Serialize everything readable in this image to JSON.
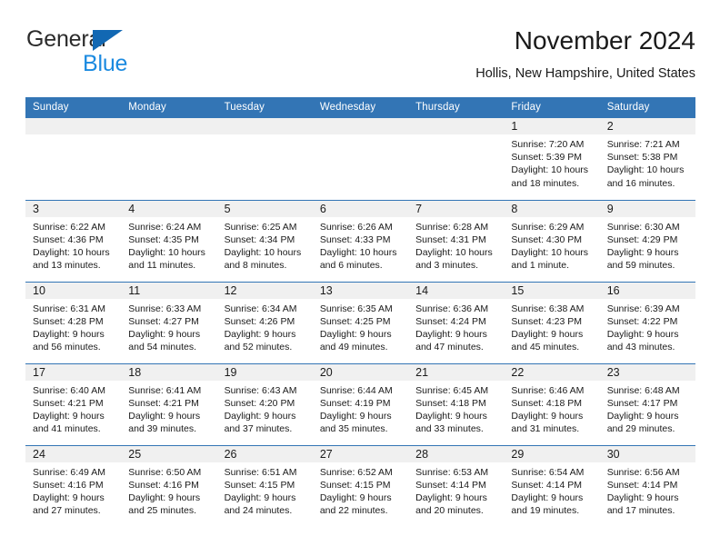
{
  "brand": {
    "name_part1": "General",
    "name_part2": "Blue",
    "accent_color": "#1b8ae0",
    "triangle_color": "#1268b3"
  },
  "header": {
    "title": "November 2024",
    "subtitle": "Hollis, New Hampshire, United States"
  },
  "theme": {
    "header_bar_color": "#3375b5",
    "day_band_color": "#f0f0f0",
    "grid_line_color": "#3375b5"
  },
  "weekdays": [
    "Sunday",
    "Monday",
    "Tuesday",
    "Wednesday",
    "Thursday",
    "Friday",
    "Saturday"
  ],
  "labels": {
    "sunrise_prefix": "Sunrise:",
    "sunset_prefix": "Sunset:",
    "daylight_prefix": "Daylight:"
  },
  "weeks": [
    [
      {
        "empty": true
      },
      {
        "empty": true
      },
      {
        "empty": true
      },
      {
        "empty": true
      },
      {
        "empty": true
      },
      {
        "day": "1",
        "sunrise": "Sunrise: 7:20 AM",
        "sunset": "Sunset: 5:39 PM",
        "daylight": "Daylight: 10 hours and 18 minutes."
      },
      {
        "day": "2",
        "sunrise": "Sunrise: 7:21 AM",
        "sunset": "Sunset: 5:38 PM",
        "daylight": "Daylight: 10 hours and 16 minutes."
      }
    ],
    [
      {
        "day": "3",
        "sunrise": "Sunrise: 6:22 AM",
        "sunset": "Sunset: 4:36 PM",
        "daylight": "Daylight: 10 hours and 13 minutes."
      },
      {
        "day": "4",
        "sunrise": "Sunrise: 6:24 AM",
        "sunset": "Sunset: 4:35 PM",
        "daylight": "Daylight: 10 hours and 11 minutes."
      },
      {
        "day": "5",
        "sunrise": "Sunrise: 6:25 AM",
        "sunset": "Sunset: 4:34 PM",
        "daylight": "Daylight: 10 hours and 8 minutes."
      },
      {
        "day": "6",
        "sunrise": "Sunrise: 6:26 AM",
        "sunset": "Sunset: 4:33 PM",
        "daylight": "Daylight: 10 hours and 6 minutes."
      },
      {
        "day": "7",
        "sunrise": "Sunrise: 6:28 AM",
        "sunset": "Sunset: 4:31 PM",
        "daylight": "Daylight: 10 hours and 3 minutes."
      },
      {
        "day": "8",
        "sunrise": "Sunrise: 6:29 AM",
        "sunset": "Sunset: 4:30 PM",
        "daylight": "Daylight: 10 hours and 1 minute."
      },
      {
        "day": "9",
        "sunrise": "Sunrise: 6:30 AM",
        "sunset": "Sunset: 4:29 PM",
        "daylight": "Daylight: 9 hours and 59 minutes."
      }
    ],
    [
      {
        "day": "10",
        "sunrise": "Sunrise: 6:31 AM",
        "sunset": "Sunset: 4:28 PM",
        "daylight": "Daylight: 9 hours and 56 minutes."
      },
      {
        "day": "11",
        "sunrise": "Sunrise: 6:33 AM",
        "sunset": "Sunset: 4:27 PM",
        "daylight": "Daylight: 9 hours and 54 minutes."
      },
      {
        "day": "12",
        "sunrise": "Sunrise: 6:34 AM",
        "sunset": "Sunset: 4:26 PM",
        "daylight": "Daylight: 9 hours and 52 minutes."
      },
      {
        "day": "13",
        "sunrise": "Sunrise: 6:35 AM",
        "sunset": "Sunset: 4:25 PM",
        "daylight": "Daylight: 9 hours and 49 minutes."
      },
      {
        "day": "14",
        "sunrise": "Sunrise: 6:36 AM",
        "sunset": "Sunset: 4:24 PM",
        "daylight": "Daylight: 9 hours and 47 minutes."
      },
      {
        "day": "15",
        "sunrise": "Sunrise: 6:38 AM",
        "sunset": "Sunset: 4:23 PM",
        "daylight": "Daylight: 9 hours and 45 minutes."
      },
      {
        "day": "16",
        "sunrise": "Sunrise: 6:39 AM",
        "sunset": "Sunset: 4:22 PM",
        "daylight": "Daylight: 9 hours and 43 minutes."
      }
    ],
    [
      {
        "day": "17",
        "sunrise": "Sunrise: 6:40 AM",
        "sunset": "Sunset: 4:21 PM",
        "daylight": "Daylight: 9 hours and 41 minutes."
      },
      {
        "day": "18",
        "sunrise": "Sunrise: 6:41 AM",
        "sunset": "Sunset: 4:21 PM",
        "daylight": "Daylight: 9 hours and 39 minutes."
      },
      {
        "day": "19",
        "sunrise": "Sunrise: 6:43 AM",
        "sunset": "Sunset: 4:20 PM",
        "daylight": "Daylight: 9 hours and 37 minutes."
      },
      {
        "day": "20",
        "sunrise": "Sunrise: 6:44 AM",
        "sunset": "Sunset: 4:19 PM",
        "daylight": "Daylight: 9 hours and 35 minutes."
      },
      {
        "day": "21",
        "sunrise": "Sunrise: 6:45 AM",
        "sunset": "Sunset: 4:18 PM",
        "daylight": "Daylight: 9 hours and 33 minutes."
      },
      {
        "day": "22",
        "sunrise": "Sunrise: 6:46 AM",
        "sunset": "Sunset: 4:18 PM",
        "daylight": "Daylight: 9 hours and 31 minutes."
      },
      {
        "day": "23",
        "sunrise": "Sunrise: 6:48 AM",
        "sunset": "Sunset: 4:17 PM",
        "daylight": "Daylight: 9 hours and 29 minutes."
      }
    ],
    [
      {
        "day": "24",
        "sunrise": "Sunrise: 6:49 AM",
        "sunset": "Sunset: 4:16 PM",
        "daylight": "Daylight: 9 hours and 27 minutes."
      },
      {
        "day": "25",
        "sunrise": "Sunrise: 6:50 AM",
        "sunset": "Sunset: 4:16 PM",
        "daylight": "Daylight: 9 hours and 25 minutes."
      },
      {
        "day": "26",
        "sunrise": "Sunrise: 6:51 AM",
        "sunset": "Sunset: 4:15 PM",
        "daylight": "Daylight: 9 hours and 24 minutes."
      },
      {
        "day": "27",
        "sunrise": "Sunrise: 6:52 AM",
        "sunset": "Sunset: 4:15 PM",
        "daylight": "Daylight: 9 hours and 22 minutes."
      },
      {
        "day": "28",
        "sunrise": "Sunrise: 6:53 AM",
        "sunset": "Sunset: 4:14 PM",
        "daylight": "Daylight: 9 hours and 20 minutes."
      },
      {
        "day": "29",
        "sunrise": "Sunrise: 6:54 AM",
        "sunset": "Sunset: 4:14 PM",
        "daylight": "Daylight: 9 hours and 19 minutes."
      },
      {
        "day": "30",
        "sunrise": "Sunrise: 6:56 AM",
        "sunset": "Sunset: 4:14 PM",
        "daylight": "Daylight: 9 hours and 17 minutes."
      }
    ]
  ]
}
